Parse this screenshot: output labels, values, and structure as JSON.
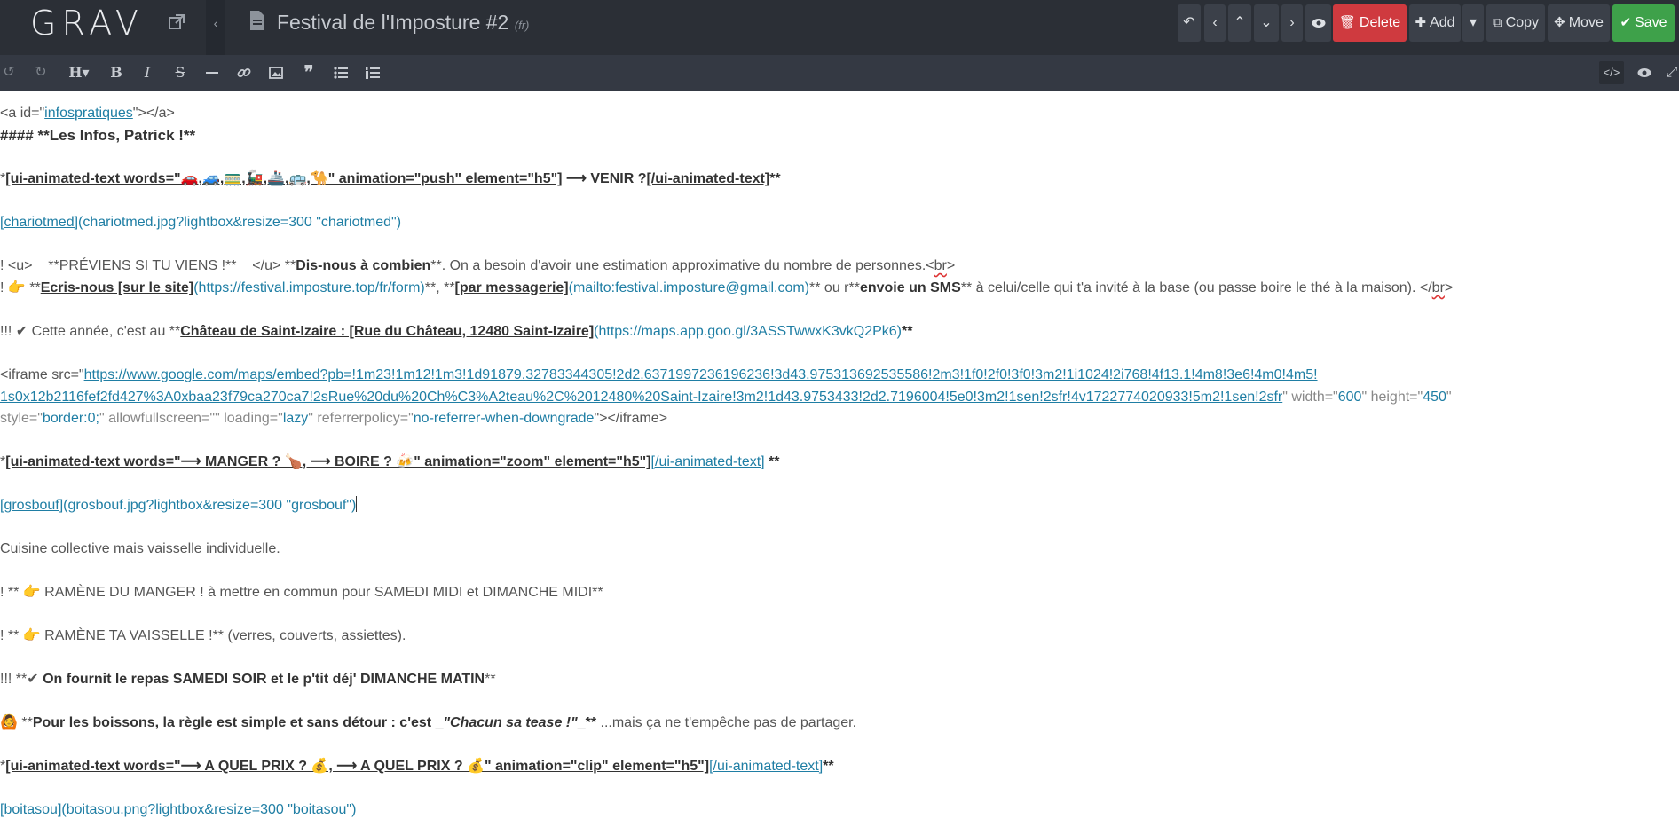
{
  "header": {
    "logo": "GRAV",
    "title": "Festival de l'Imposture #2",
    "lang": "(fr)",
    "buttons": {
      "delete": "Delete",
      "add": "Add",
      "copy": "Copy",
      "move": "Move",
      "save": "Save"
    }
  },
  "editor": {
    "lines": {
      "l1a": "<a id=\"",
      "l1b": "infospratiques",
      "l1c": "\"></a>",
      "l2": "#### **Les Infos, Patrick !**",
      "l3a": "*",
      "l3b": "[ui-animated-text words=\"🚗,🚙,🚃,🚂,🚢,🚌,🐪\" animation=\"push\" element=\"h5\"]",
      "l3c": "⟶ VENIR ?",
      "l3d": "[/ui-animated-text]",
      "l3e": "**",
      "l4a": "[chariotmed]",
      "l4b": "(chariotmed.jpg?lightbox&resize=300 \"chariotmed\")",
      "l5a": "! <u>__**PRÉVIENS SI TU VIENS !**__</u> **",
      "l5b": "Dis-nous à combien",
      "l5c": "**. On a besoin d'avoir une estimation approximative du nombre de personnes.<",
      "l5d": "br",
      "l5e": ">",
      "l6a": "! 👉 **",
      "l6b": "Ecris-nous [sur le site]",
      "l6c": "(https://festival.imposture.top/fr/form)",
      "l6d": "**, **",
      "l6e": "[par messagerie]",
      "l6f": "(mailto:festival.imposture@gmail.com)",
      "l6g": "** ou r**",
      "l6h": "envoie un SMS",
      "l6i": "** à celui/celle qui t'a invité à la base (ou passe boire le thé à la maison). </",
      "l6j": "br",
      "l6k": ">",
      "l7a": "!!! ✔ Cette année, c'est au **",
      "l7b": "Château de Saint-Izaire : [Rue du Château, 12480 Saint-Izaire]",
      "l7c": "(https://maps.app.goo.gl/3ASSTwwxK3vkQ2Pk6)",
      "l7d": "**",
      "l8a": "<iframe src=\"",
      "l8b": "https://www.google.com/maps/embed?pb=!1m23!1m12!1m3!1d91879.32783344305!2d2.6371997236196236!3d43.975313692535586!2m3!1f0!2f0!3f0!3m2!1i1024!2i768!4f13.1!4m8!3e6!4m0!4m5!",
      "l9a": "1s0x12b2116fef2fd427%3A0xbaa23f79ca270ca7!2sRue%20du%20Ch%C3%A2teau%2C%2012480%20Saint-Izaire!3m2!1d43.9753433!2d2.7196004!5e0!3m2!1sen!2sfr!4v1722774020933!5m2!1sen!2sfr",
      "l9b": "\" width=\"",
      "l9c": "600",
      "l9d": "\" height=\"",
      "l9e": "450",
      "l9f": "\"",
      "l10a": "style=\"",
      "l10b": "border:0;",
      "l10c": "\" allowfullscreen=\"",
      "l10d": "\" loading=\"",
      "l10e": "lazy",
      "l10f": "\" referrerpolicy=\"",
      "l10g": "no-referrer-when-downgrade",
      "l10h": "\"></iframe>",
      "l11a": "*",
      "l11b": "[ui-animated-text words=\"⟶ MANGER ? 🍗, ⟶ BOIRE ? 🍻\" animation=\"zoom\" element=\"h5\"]",
      "l11c": "[/ui-animated-text]",
      "l11d": "  **",
      "l12a": "[grosbouf]",
      "l12b": "(grosbouf.jpg?lightbox&resize=300 \"grosbouf\")",
      "l13": "Cuisine collective mais vaisselle individuelle.",
      "l14": "! ** 👉 RAMÈNE DU MANGER ! à mettre en commun pour SAMEDI MIDI et DIMANCHE MIDI**",
      "l15": "! ** 👉 RAMÈNE TA VAISSELLE !** (verres, couverts, assiettes).",
      "l16a": "!!! **✔ ",
      "l16b": "On fournit le repas SAMEDI SOIR et le p'tit déj' DIMANCHE MATIN",
      "l16c": "**",
      "l17a": "🙆 **",
      "l17b": "Pour les boissons, la règle est simple et sans détour : c'est _",
      "l17c": "\"Chacun sa tease !\"",
      "l17d": "_**",
      "l17e": " ...mais ça ne t'empêche pas de partager.",
      "l18a": "*",
      "l18b": "[ui-animated-text words=\"⟶ A QUEL PRIX ? 💰, ⟶ A QUEL PRIX ? 💰\" animation=\"clip\" element=\"h5\"]",
      "l18c": "[/ui-animated-text]",
      "l18d": "**",
      "l19a": "[boitasou]",
      "l19b": "(boitasou.png?lightbox&resize=300 \"boitasou\")"
    }
  }
}
